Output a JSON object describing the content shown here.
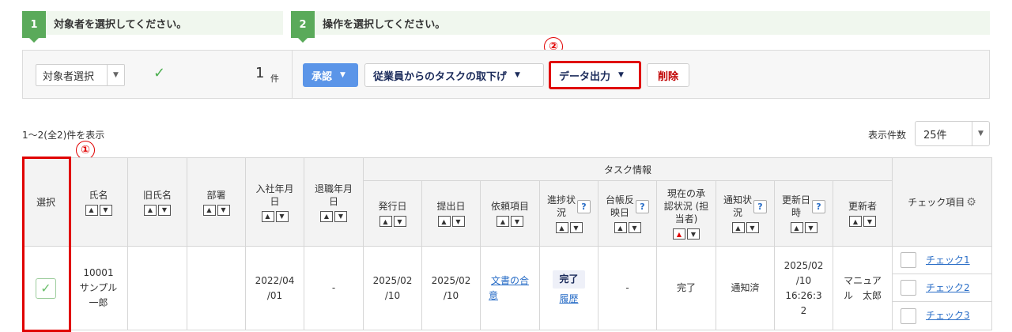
{
  "steps": [
    {
      "number": "1",
      "text": "対象者を選択してください。"
    },
    {
      "number": "2",
      "text": "操作を選択してください。"
    }
  ],
  "toolbar": {
    "target_select_label": "対象者選択",
    "selected_count": "1",
    "selected_unit": "件",
    "approve_label": "承認",
    "withdraw_label": "従業員からのタスクの取下げ",
    "export_label": "データ出力",
    "delete_label": "削除"
  },
  "markers": {
    "one": "①",
    "two": "②"
  },
  "list": {
    "range_text": "1〜2(全2)件を表示",
    "per_page_label": "表示件数",
    "per_page_value": "25件"
  },
  "table": {
    "group_header": "タスク情報",
    "columns": {
      "select": "選択",
      "name": "氏名",
      "former_name": "旧氏名",
      "department": "部署",
      "hire_date": [
        "入社年月",
        "日"
      ],
      "leave_date": [
        "退職年月",
        "日"
      ],
      "issue_date": "発行日",
      "submit_date": "提出日",
      "request_item": "依頼項目",
      "progress": [
        "進捗状",
        "況"
      ],
      "ledger": [
        "台帳反",
        "映日"
      ],
      "approval": [
        "現在の承",
        "認状況 (担",
        "当者)"
      ],
      "notice": [
        "通知状",
        "況"
      ],
      "updated_at": [
        "更新日",
        "時"
      ],
      "updater": "更新者",
      "check_items": "チェック項目"
    },
    "row": {
      "name": [
        "10001",
        "サンプル",
        "一郎"
      ],
      "former_name": "",
      "department": "",
      "hire_date": [
        "2022/04",
        "/01"
      ],
      "leave_date": "-",
      "issue_date": [
        "2025/02",
        "/10"
      ],
      "submit_date": [
        "2025/02",
        "/10"
      ],
      "request_item": [
        "文書の合",
        "意"
      ],
      "progress_badge": "完了",
      "progress_link": "履歴",
      "ledger": "-",
      "approval": "完了",
      "notice": "通知済",
      "updated_at": [
        "2025/02",
        "/10",
        "16:26:3",
        "2"
      ],
      "updater": [
        "マニュア",
        "ル　太郎"
      ],
      "check_items": [
        "チェック1",
        "チェック2",
        "チェック3"
      ]
    }
  }
}
